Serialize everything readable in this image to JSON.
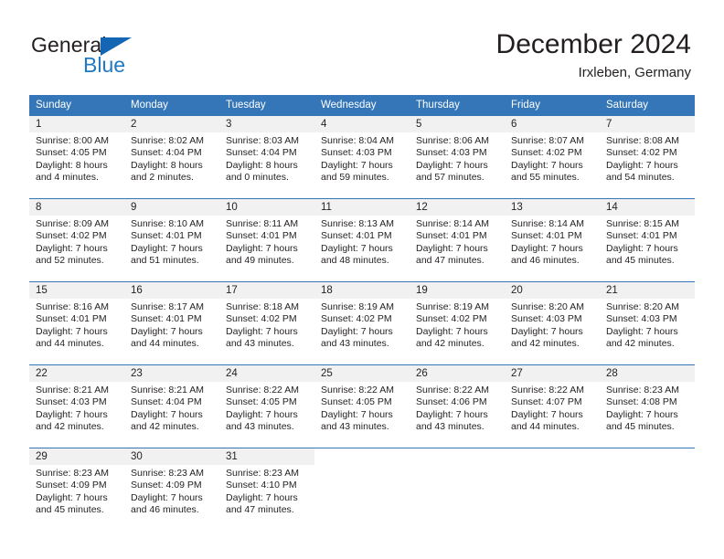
{
  "brand": {
    "name_part1": "General",
    "name_part2": "Blue",
    "accent_color": "#1f7ac4",
    "triangle_color": "#1565b5"
  },
  "header": {
    "month_title": "December 2024",
    "location": "Irxleben, Germany"
  },
  "calendar": {
    "header_bg": "#3476b8",
    "daynum_band_bg": "#f1f1f1",
    "weekday_headers": [
      "Sunday",
      "Monday",
      "Tuesday",
      "Wednesday",
      "Thursday",
      "Friday",
      "Saturday"
    ],
    "weeks": [
      [
        {
          "day": "1",
          "sunrise": "Sunrise: 8:00 AM",
          "sunset": "Sunset: 4:05 PM",
          "daylight_line1": "Daylight: 8 hours",
          "daylight_line2": "and 4 minutes."
        },
        {
          "day": "2",
          "sunrise": "Sunrise: 8:02 AM",
          "sunset": "Sunset: 4:04 PM",
          "daylight_line1": "Daylight: 8 hours",
          "daylight_line2": "and 2 minutes."
        },
        {
          "day": "3",
          "sunrise": "Sunrise: 8:03 AM",
          "sunset": "Sunset: 4:04 PM",
          "daylight_line1": "Daylight: 8 hours",
          "daylight_line2": "and 0 minutes."
        },
        {
          "day": "4",
          "sunrise": "Sunrise: 8:04 AM",
          "sunset": "Sunset: 4:03 PM",
          "daylight_line1": "Daylight: 7 hours",
          "daylight_line2": "and 59 minutes."
        },
        {
          "day": "5",
          "sunrise": "Sunrise: 8:06 AM",
          "sunset": "Sunset: 4:03 PM",
          "daylight_line1": "Daylight: 7 hours",
          "daylight_line2": "and 57 minutes."
        },
        {
          "day": "6",
          "sunrise": "Sunrise: 8:07 AM",
          "sunset": "Sunset: 4:02 PM",
          "daylight_line1": "Daylight: 7 hours",
          "daylight_line2": "and 55 minutes."
        },
        {
          "day": "7",
          "sunrise": "Sunrise: 8:08 AM",
          "sunset": "Sunset: 4:02 PM",
          "daylight_line1": "Daylight: 7 hours",
          "daylight_line2": "and 54 minutes."
        }
      ],
      [
        {
          "day": "8",
          "sunrise": "Sunrise: 8:09 AM",
          "sunset": "Sunset: 4:02 PM",
          "daylight_line1": "Daylight: 7 hours",
          "daylight_line2": "and 52 minutes."
        },
        {
          "day": "9",
          "sunrise": "Sunrise: 8:10 AM",
          "sunset": "Sunset: 4:01 PM",
          "daylight_line1": "Daylight: 7 hours",
          "daylight_line2": "and 51 minutes."
        },
        {
          "day": "10",
          "sunrise": "Sunrise: 8:11 AM",
          "sunset": "Sunset: 4:01 PM",
          "daylight_line1": "Daylight: 7 hours",
          "daylight_line2": "and 49 minutes."
        },
        {
          "day": "11",
          "sunrise": "Sunrise: 8:13 AM",
          "sunset": "Sunset: 4:01 PM",
          "daylight_line1": "Daylight: 7 hours",
          "daylight_line2": "and 48 minutes."
        },
        {
          "day": "12",
          "sunrise": "Sunrise: 8:14 AM",
          "sunset": "Sunset: 4:01 PM",
          "daylight_line1": "Daylight: 7 hours",
          "daylight_line2": "and 47 minutes."
        },
        {
          "day": "13",
          "sunrise": "Sunrise: 8:14 AM",
          "sunset": "Sunset: 4:01 PM",
          "daylight_line1": "Daylight: 7 hours",
          "daylight_line2": "and 46 minutes."
        },
        {
          "day": "14",
          "sunrise": "Sunrise: 8:15 AM",
          "sunset": "Sunset: 4:01 PM",
          "daylight_line1": "Daylight: 7 hours",
          "daylight_line2": "and 45 minutes."
        }
      ],
      [
        {
          "day": "15",
          "sunrise": "Sunrise: 8:16 AM",
          "sunset": "Sunset: 4:01 PM",
          "daylight_line1": "Daylight: 7 hours",
          "daylight_line2": "and 44 minutes."
        },
        {
          "day": "16",
          "sunrise": "Sunrise: 8:17 AM",
          "sunset": "Sunset: 4:01 PM",
          "daylight_line1": "Daylight: 7 hours",
          "daylight_line2": "and 44 minutes."
        },
        {
          "day": "17",
          "sunrise": "Sunrise: 8:18 AM",
          "sunset": "Sunset: 4:02 PM",
          "daylight_line1": "Daylight: 7 hours",
          "daylight_line2": "and 43 minutes."
        },
        {
          "day": "18",
          "sunrise": "Sunrise: 8:19 AM",
          "sunset": "Sunset: 4:02 PM",
          "daylight_line1": "Daylight: 7 hours",
          "daylight_line2": "and 43 minutes."
        },
        {
          "day": "19",
          "sunrise": "Sunrise: 8:19 AM",
          "sunset": "Sunset: 4:02 PM",
          "daylight_line1": "Daylight: 7 hours",
          "daylight_line2": "and 42 minutes."
        },
        {
          "day": "20",
          "sunrise": "Sunrise: 8:20 AM",
          "sunset": "Sunset: 4:03 PM",
          "daylight_line1": "Daylight: 7 hours",
          "daylight_line2": "and 42 minutes."
        },
        {
          "day": "21",
          "sunrise": "Sunrise: 8:20 AM",
          "sunset": "Sunset: 4:03 PM",
          "daylight_line1": "Daylight: 7 hours",
          "daylight_line2": "and 42 minutes."
        }
      ],
      [
        {
          "day": "22",
          "sunrise": "Sunrise: 8:21 AM",
          "sunset": "Sunset: 4:03 PM",
          "daylight_line1": "Daylight: 7 hours",
          "daylight_line2": "and 42 minutes."
        },
        {
          "day": "23",
          "sunrise": "Sunrise: 8:21 AM",
          "sunset": "Sunset: 4:04 PM",
          "daylight_line1": "Daylight: 7 hours",
          "daylight_line2": "and 42 minutes."
        },
        {
          "day": "24",
          "sunrise": "Sunrise: 8:22 AM",
          "sunset": "Sunset: 4:05 PM",
          "daylight_line1": "Daylight: 7 hours",
          "daylight_line2": "and 43 minutes."
        },
        {
          "day": "25",
          "sunrise": "Sunrise: 8:22 AM",
          "sunset": "Sunset: 4:05 PM",
          "daylight_line1": "Daylight: 7 hours",
          "daylight_line2": "and 43 minutes."
        },
        {
          "day": "26",
          "sunrise": "Sunrise: 8:22 AM",
          "sunset": "Sunset: 4:06 PM",
          "daylight_line1": "Daylight: 7 hours",
          "daylight_line2": "and 43 minutes."
        },
        {
          "day": "27",
          "sunrise": "Sunrise: 8:22 AM",
          "sunset": "Sunset: 4:07 PM",
          "daylight_line1": "Daylight: 7 hours",
          "daylight_line2": "and 44 minutes."
        },
        {
          "day": "28",
          "sunrise": "Sunrise: 8:23 AM",
          "sunset": "Sunset: 4:08 PM",
          "daylight_line1": "Daylight: 7 hours",
          "daylight_line2": "and 45 minutes."
        }
      ],
      [
        {
          "day": "29",
          "sunrise": "Sunrise: 8:23 AM",
          "sunset": "Sunset: 4:09 PM",
          "daylight_line1": "Daylight: 7 hours",
          "daylight_line2": "and 45 minutes."
        },
        {
          "day": "30",
          "sunrise": "Sunrise: 8:23 AM",
          "sunset": "Sunset: 4:09 PM",
          "daylight_line1": "Daylight: 7 hours",
          "daylight_line2": "and 46 minutes."
        },
        {
          "day": "31",
          "sunrise": "Sunrise: 8:23 AM",
          "sunset": "Sunset: 4:10 PM",
          "daylight_line1": "Daylight: 7 hours",
          "daylight_line2": "and 47 minutes."
        },
        {
          "day": "",
          "sunrise": "",
          "sunset": "",
          "daylight_line1": "",
          "daylight_line2": ""
        },
        {
          "day": "",
          "sunrise": "",
          "sunset": "",
          "daylight_line1": "",
          "daylight_line2": ""
        },
        {
          "day": "",
          "sunrise": "",
          "sunset": "",
          "daylight_line1": "",
          "daylight_line2": ""
        },
        {
          "day": "",
          "sunrise": "",
          "sunset": "",
          "daylight_line1": "",
          "daylight_line2": ""
        }
      ]
    ]
  }
}
